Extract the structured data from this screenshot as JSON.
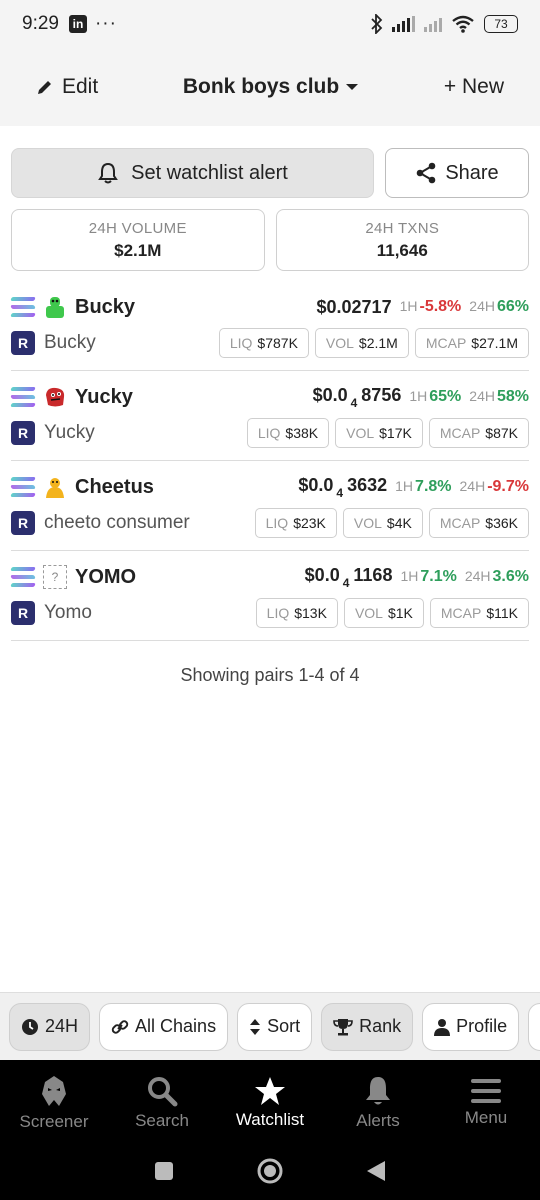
{
  "status_bar": {
    "time": "9:29",
    "battery": "73"
  },
  "header": {
    "edit_label": "Edit",
    "title": "Bonk boys club",
    "new_label": "+ New"
  },
  "actions": {
    "alert_label": "Set watchlist alert",
    "share_label": "Share"
  },
  "stats": [
    {
      "label": "24H VOLUME",
      "value": "$2.1M"
    },
    {
      "label": "24H TXNS",
      "value": "11,646"
    }
  ],
  "pairs": [
    {
      "symbol": "Bucky",
      "name": "Bucky",
      "price_main": "$0.02717",
      "price_zeros": "",
      "price_rest": "",
      "h1_label": "1H",
      "h1": "-5.8%",
      "h24_label": "24H",
      "h24": "66%",
      "liq_label": "LIQ",
      "liq": "$787K",
      "vol_label": "VOL",
      "vol": "$2.1M",
      "mcap_label": "MCAP",
      "mcap": "$27.1M"
    },
    {
      "symbol": "Yucky",
      "name": "Yucky",
      "price_main": "$0.0",
      "price_zeros": "4",
      "price_rest": "8756",
      "h1_label": "1H",
      "h1": "65%",
      "h24_label": "24H",
      "h24": "58%",
      "liq_label": "LIQ",
      "liq": "$38K",
      "vol_label": "VOL",
      "vol": "$17K",
      "mcap_label": "MCAP",
      "mcap": "$87K"
    },
    {
      "symbol": "Cheetus",
      "name": "cheeto consumer",
      "price_main": "$0.0",
      "price_zeros": "4",
      "price_rest": "3632",
      "h1_label": "1H",
      "h1": "7.8%",
      "h24_label": "24H",
      "h24": "-9.7%",
      "liq_label": "LIQ",
      "liq": "$23K",
      "vol_label": "VOL",
      "vol": "$4K",
      "mcap_label": "MCAP",
      "mcap": "$36K"
    },
    {
      "symbol": "YOMO",
      "name": "Yomo",
      "price_main": "$0.0",
      "price_zeros": "4",
      "price_rest": "1168",
      "h1_label": "1H",
      "h1": "7.1%",
      "h24_label": "24H",
      "h24": "3.6%",
      "liq_label": "LIQ",
      "liq": "$13K",
      "vol_label": "VOL",
      "vol": "$1K",
      "mcap_label": "MCAP",
      "mcap": "$11K"
    }
  ],
  "showing": "Showing pairs 1-4 of 4",
  "filters": {
    "timeframe": "24H",
    "chains": "All Chains",
    "sort": "Sort",
    "rank": "Rank",
    "profile": "Profile"
  },
  "nav": {
    "screener": "Screener",
    "search": "Search",
    "watchlist": "Watchlist",
    "alerts": "Alerts",
    "menu": "Menu"
  },
  "colors": {
    "positive": "#2e9e5b",
    "negative": "#d9383a",
    "dex": "#2c2f6e"
  },
  "token_icons": [
    "green-frog-icon",
    "red-creature-icon",
    "yellow-cheetus-icon",
    "placeholder-icon"
  ]
}
